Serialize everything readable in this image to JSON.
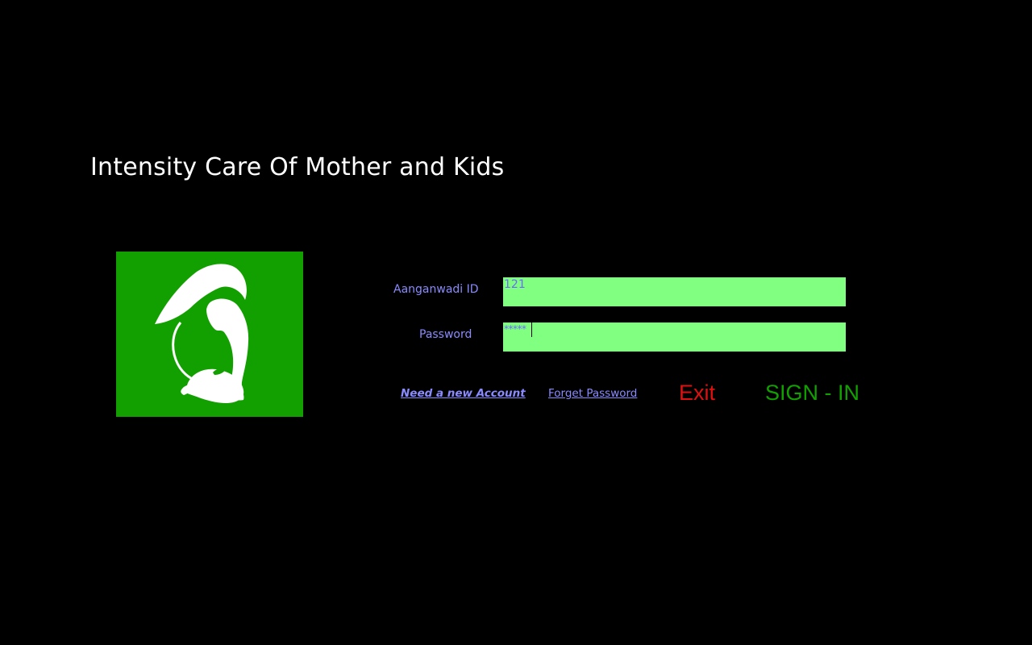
{
  "app": {
    "title": "Intensity Care Of Mother and Kids"
  },
  "logo": {
    "icon": "mother-and-child-icon",
    "background_color": "#12a000"
  },
  "form": {
    "id_label": "Aanganwadi ID",
    "id_value": "121",
    "password_label": "Password",
    "password_value": "*****",
    "field_color": "#80ff80"
  },
  "actions": {
    "new_account": "Need a new Account",
    "forget_password": "Forget Password",
    "exit": "Exit",
    "sign_in": "SIGN - IN"
  },
  "colors": {
    "background": "#000000",
    "label": "#8a8aff",
    "exit": "#e01010",
    "sign_in": "#12a000"
  }
}
